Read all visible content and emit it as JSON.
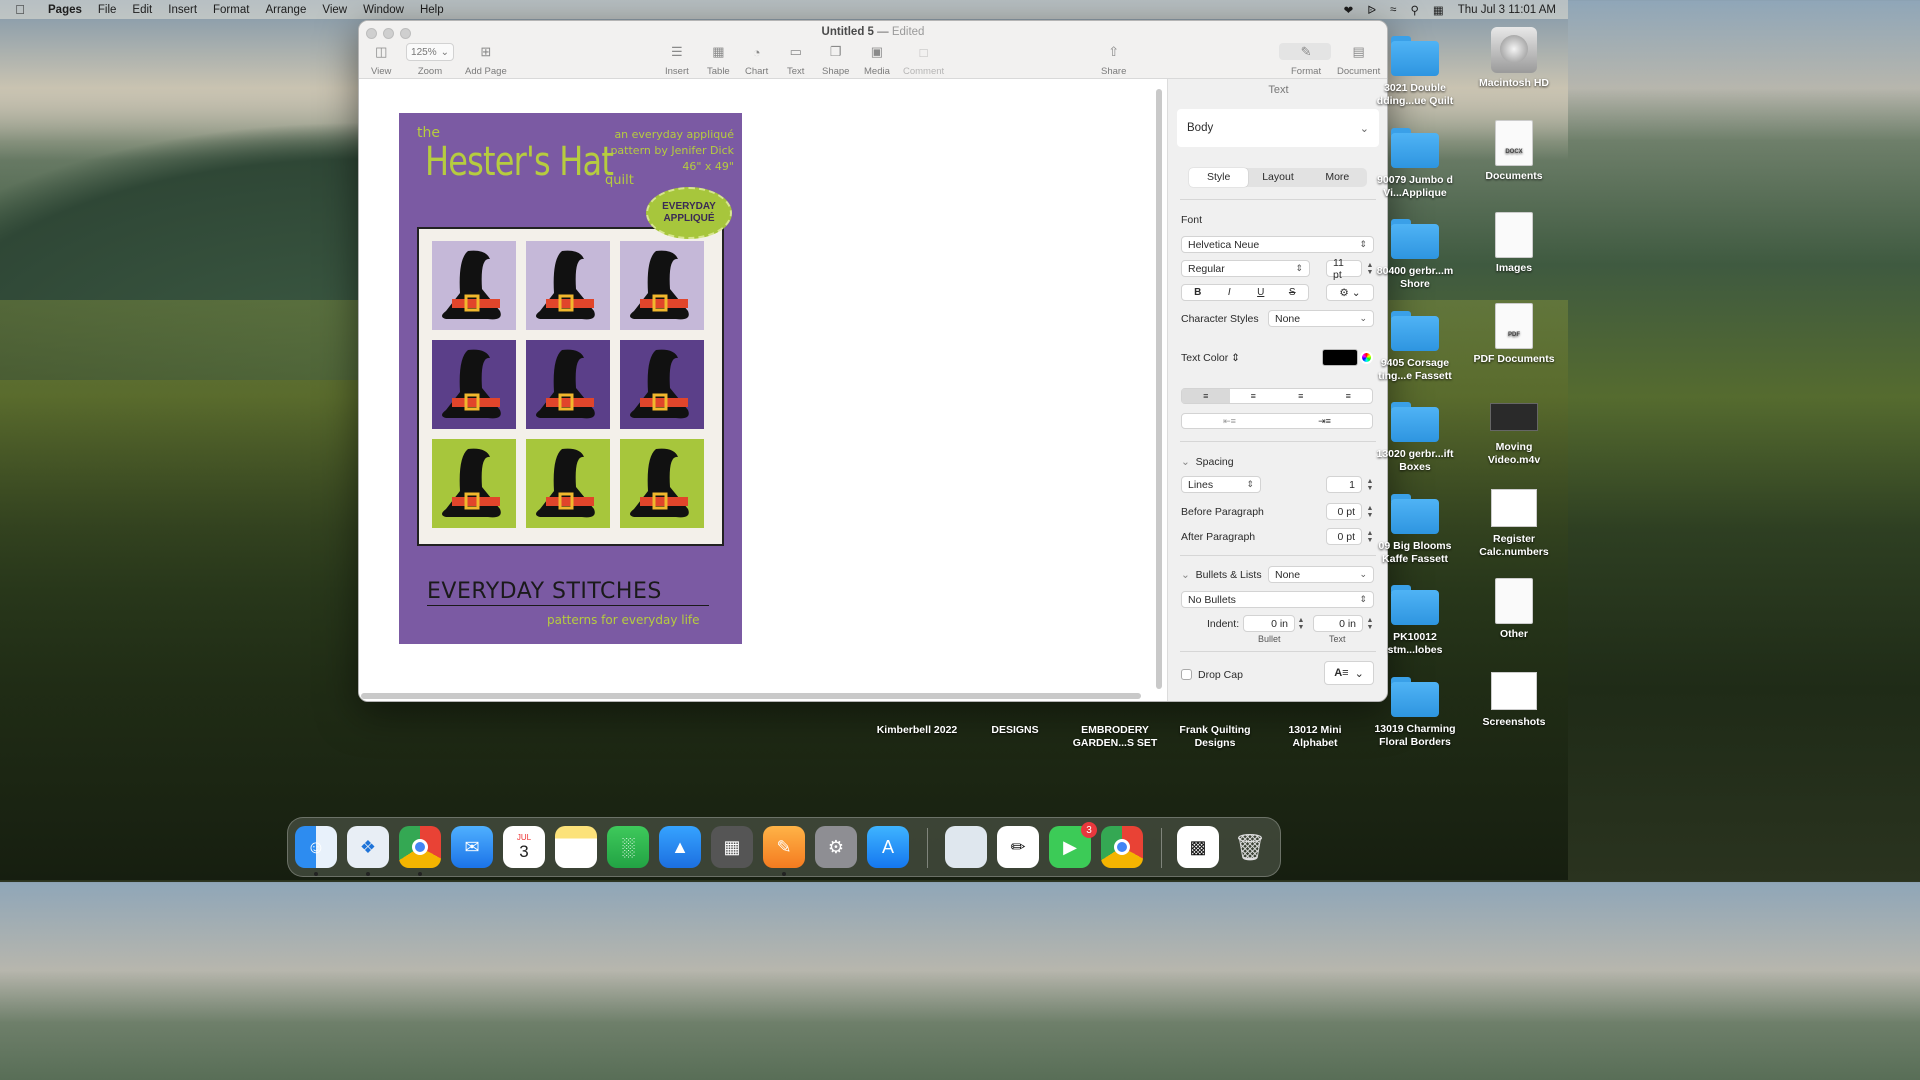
{
  "menubar": {
    "app_name": "Pages",
    "items": [
      "File",
      "Edit",
      "Insert",
      "Format",
      "Arrange",
      "View",
      "Window",
      "Help"
    ],
    "clock": "Thu Jul 3  11:01 AM"
  },
  "window": {
    "doc_title": "Untitled 5",
    "edited": "Edited",
    "toolbar": {
      "view": "View",
      "zoom_value": "125%",
      "zoom": "Zoom",
      "add_page": "Add Page",
      "insert": "Insert",
      "table": "Table",
      "chart": "Chart",
      "text": "Text",
      "shape": "Shape",
      "media": "Media",
      "comment": "Comment",
      "share": "Share",
      "format": "Format",
      "document": "Document"
    }
  },
  "poster": {
    "the": "the",
    "title": "Hester's Hat",
    "quilt": "quilt",
    "credit_line1": "an everyday appliqué",
    "credit_line2": "pattern by Jenifer Dick",
    "credit_line3": "46\" x 49\"",
    "badge_line1": "EVERYDAY",
    "badge_line2": "APPLIQUÉ",
    "brand": "EVERYDAY STITCHES",
    "tagline": "patterns for everyday life",
    "colors": {
      "background": "#7b5aa3",
      "lime": "#a7c63c",
      "lavender": "#c5b8d8",
      "purple": "#5b3f89"
    }
  },
  "inspector": {
    "header": "Text",
    "paragraph_style": "Body",
    "tabs": [
      "Style",
      "Layout",
      "More"
    ],
    "active_tab": "Style",
    "font_label": "Font",
    "font_family": "Helvetica Neue",
    "font_style": "Regular",
    "font_size": "11 pt",
    "bold": "B",
    "italic": "I",
    "underline": "U",
    "strike": "S",
    "character_styles_label": "Character Styles",
    "character_styles_value": "None",
    "text_color_label": "Text Color",
    "text_color": "#000000",
    "spacing_label": "Spacing",
    "spacing_mode": "Lines",
    "spacing_value": "1",
    "before_paragraph_label": "Before Paragraph",
    "before_paragraph_value": "0 pt",
    "after_paragraph_label": "After Paragraph",
    "after_paragraph_value": "0 pt",
    "bullets_label": "Bullets & Lists",
    "bullets_value": "None",
    "bullet_type": "No Bullets",
    "indent_label": "Indent:",
    "indent_bullet_value": "0 in",
    "indent_text_value": "0 in",
    "indent_bullet_caption": "Bullet",
    "indent_text_caption": "Text",
    "drop_cap_label": "Drop Cap",
    "drop_cap_glyph": "A"
  },
  "desktop": {
    "right_column": [
      {
        "label": "Macintosh HD",
        "kind": "hdd"
      },
      {
        "label": "Documents",
        "kind": "doc",
        "tag": "DOCX"
      },
      {
        "label": "Images",
        "kind": "doc",
        "tag": ""
      },
      {
        "label": "PDF Documents",
        "kind": "doc",
        "tag": "PDF"
      },
      {
        "label": "Moving Video.m4v",
        "kind": "video"
      },
      {
        "label": "Register Calc.numbers",
        "kind": "sheet"
      },
      {
        "label": "Other",
        "kind": "doc",
        "tag": ""
      },
      {
        "label": "Screenshots",
        "kind": "thumb"
      }
    ],
    "second_column": [
      {
        "label": "3021 Double dding...ue Quilt"
      },
      {
        "label": "90079 Jumbo d Vi...Applique"
      },
      {
        "label": "80400 gerbr...m Shore"
      },
      {
        "label": "9405 Corsage ting...e Fassett"
      },
      {
        "label": "13020 gerbr...ift Boxes"
      },
      {
        "label": "09 Big Blooms Kaffe Fassett"
      },
      {
        "label": "PK10012 stm...lobes"
      },
      {
        "label": "13019 Charming Floral Borders"
      }
    ],
    "bottom_row": [
      {
        "label": "Kimberbell 2022"
      },
      {
        "label": "DESIGNS"
      },
      {
        "label": "EMBRODERY GARDEN...S SET"
      },
      {
        "label": "Frank Quilting Designs"
      },
      {
        "label": "13012 Mini Alphabet"
      }
    ]
  },
  "dock": {
    "apps": [
      "Finder",
      "Safari",
      "Chrome",
      "Mail",
      "Calendar",
      "Notes",
      "Numbers",
      "Keynote",
      "Calculator",
      "Pages",
      "System Settings",
      "App Store",
      "Preview",
      "Pen Tool",
      "FaceTime",
      "Chrome",
      "QR Code",
      "Trash"
    ],
    "calendar_month": "JUL",
    "calendar_day": "3",
    "facetime_badge": "3"
  }
}
